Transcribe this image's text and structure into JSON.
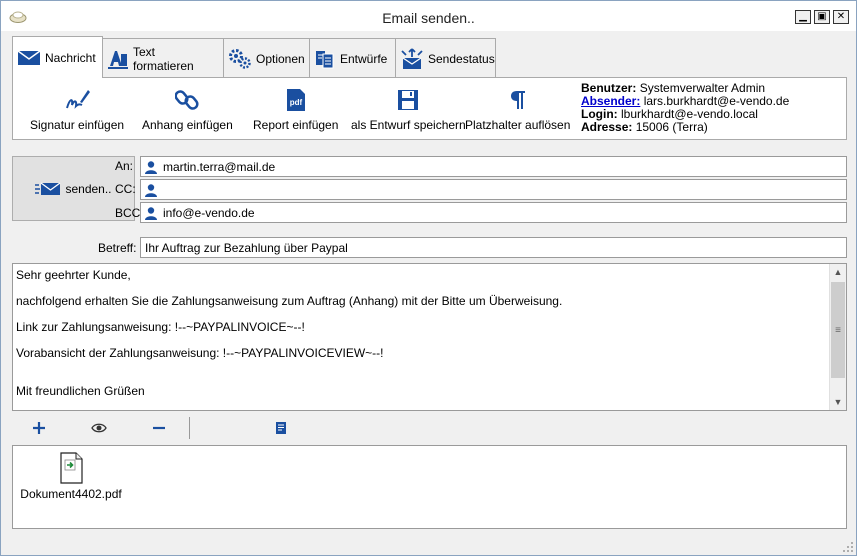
{
  "window": {
    "title": "Email senden.."
  },
  "tabs": [
    {
      "label": "Nachricht",
      "icon": "envelope-icon",
      "active": true
    },
    {
      "label": "Text formatieren",
      "icon": "text-format-icon"
    },
    {
      "label": "Optionen",
      "icon": "gears-icon"
    },
    {
      "label": "Entwürfe",
      "icon": "documents-icon"
    },
    {
      "label": "Sendestatus",
      "icon": "send-status-icon"
    }
  ],
  "ribbon": {
    "signature": "Signatur einfügen",
    "attachment": "Anhang einfügen",
    "report": "Report einfügen",
    "draft": "als Entwurf speichern",
    "placeholder": "Platzhalter auflösen"
  },
  "user_info": {
    "user_label": "Benutzer:",
    "user_value": "Systemverwalter Admin",
    "sender_label": "Absender:",
    "sender_value": "lars.burkhardt@e-vendo.de",
    "login_label": "Login:",
    "login_value": "lburkhardt@e-vendo.local",
    "address_label": "Adresse:",
    "address_value": "15006 (Terra)"
  },
  "send": {
    "label": "senden.."
  },
  "recipients": {
    "to_label": "An:",
    "to_value": "martin.terra@mail.de",
    "cc_label": "CC:",
    "cc_value": "",
    "bcc_label": "BCC:",
    "bcc_value": "info@e-vendo.de"
  },
  "subject": {
    "label": "Betreff:",
    "value": "Ihr Auftrag zur Bezahlung über Paypal"
  },
  "body": {
    "lines": [
      "Sehr geehrter Kunde,",
      "nachfolgend erhalten Sie die Zahlungsanweisung zum Auftrag (Anhang) mit der Bitte um Überweisung.",
      "Link zur Zahlungsanweisung: !--~PAYPALINVOICE~--!",
      "Vorabansicht der Zahlungsanweisung: !--~PAYPALINVOICEVIEW~--!",
      "",
      "Mit freundlichen Grüßen"
    ]
  },
  "attachments": [
    {
      "name": "Dokument4402.pdf"
    }
  ],
  "colors": {
    "accent": "#1a4fa0",
    "link": "#0000cc"
  }
}
